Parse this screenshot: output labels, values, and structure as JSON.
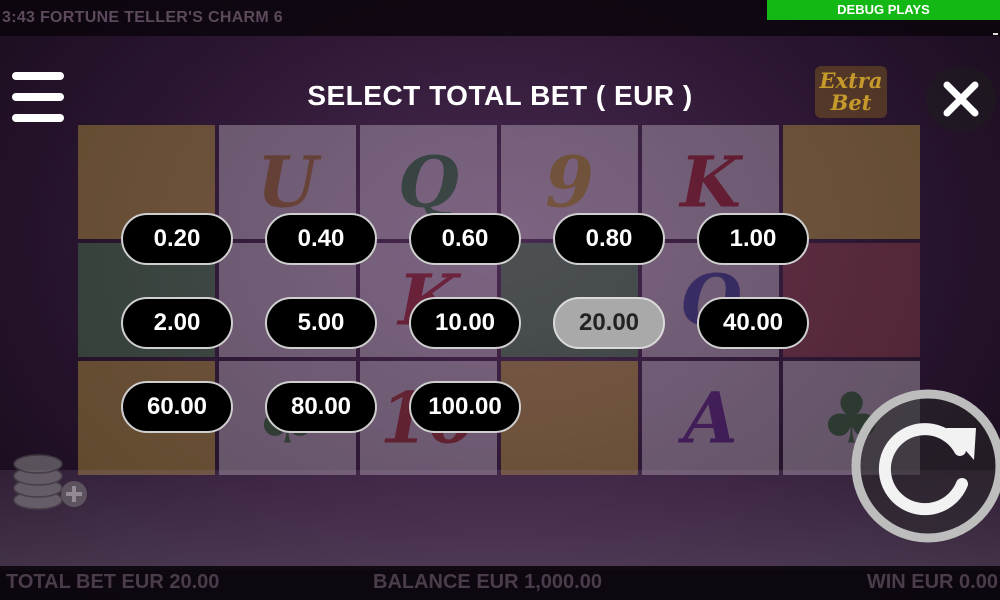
{
  "top_bar": {
    "title": "3:43  FORTUNE TELLER'S CHARM 6",
    "debug_label": "DEBUG PLAYS"
  },
  "dialog": {
    "title": "SELECT TOTAL BET ( EUR )",
    "extra_bet_line1": "Extra",
    "extra_bet_line2": "Bet"
  },
  "bet_options": [
    {
      "label": "0.20",
      "selected": false
    },
    {
      "label": "0.40",
      "selected": false
    },
    {
      "label": "0.60",
      "selected": false
    },
    {
      "label": "0.80",
      "selected": false
    },
    {
      "label": "1.00",
      "selected": false
    },
    {
      "label": "2.00",
      "selected": false
    },
    {
      "label": "5.00",
      "selected": false
    },
    {
      "label": "10.00",
      "selected": false
    },
    {
      "label": "20.00",
      "selected": true
    },
    {
      "label": "40.00",
      "selected": false
    },
    {
      "label": "60.00",
      "selected": false
    },
    {
      "label": "80.00",
      "selected": false
    },
    {
      "label": "100.00",
      "selected": false
    }
  ],
  "status": {
    "total_bet": "TOTAL BET EUR 20.00",
    "balance": "BALANCE EUR 1,000.00",
    "win": "WIN EUR 0.00"
  },
  "colors": {
    "debug_green": "#14b814",
    "selected_bet": "#a9a9a9",
    "bet_button": "#000000"
  },
  "icons": {
    "menu": "hamburger-menu-icon",
    "close": "close-icon",
    "spin": "spin-arrow-icon",
    "bet_settings": "coin-stack-plus-icon"
  }
}
